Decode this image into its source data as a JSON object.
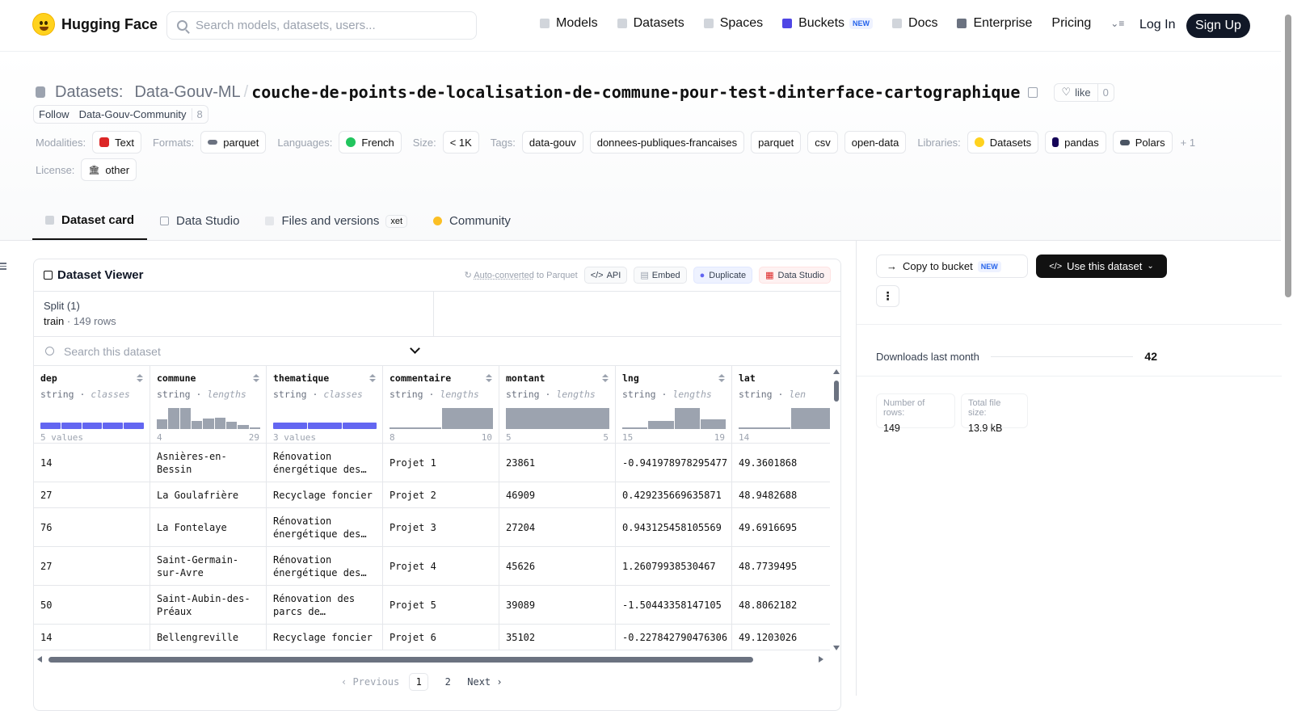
{
  "brand": "Hugging Face",
  "search_placeholder": "Search models, datasets, users...",
  "nav": {
    "models": "Models",
    "datasets": "Datasets",
    "spaces": "Spaces",
    "buckets": "Buckets",
    "buckets_badge": "NEW",
    "docs": "Docs",
    "enterprise": "Enterprise",
    "pricing": "Pricing",
    "login": "Log In",
    "signup": "Sign Up"
  },
  "dataset": {
    "label": "Datasets:",
    "org": "Data-Gouv-ML",
    "sep": "/",
    "name": "couche-de-points-de-localisation-de-commune-pour-test-dinterface-cartographique",
    "like_label": "like",
    "like_count": "0",
    "follow_label": "Follow",
    "follow_org": "Data-Gouv-Community",
    "follow_count": "8"
  },
  "meta": {
    "modalities_label": "Modalities:",
    "modality": "Text",
    "formats_label": "Formats:",
    "format": "parquet",
    "languages_label": "Languages:",
    "language": "French",
    "size_label": "Size:",
    "size": "< 1K",
    "tags_label": "Tags:",
    "tags": [
      "data-gouv",
      "donnees-publiques-francaises",
      "parquet",
      "csv",
      "open-data"
    ],
    "libraries_label": "Libraries:",
    "libraries": [
      "Datasets",
      "pandas",
      "Polars"
    ],
    "libraries_more": "+ 1",
    "license_label": "License:",
    "license": "other"
  },
  "tabs": {
    "card": "Dataset card",
    "studio": "Data Studio",
    "files": "Files and versions",
    "files_badge": "xet",
    "community": "Community"
  },
  "viewer": {
    "title": "Dataset Viewer",
    "auto_prefix": "Auto-converted",
    "auto_suffix": " to Parquet",
    "api": "API",
    "embed": "Embed",
    "duplicate": "Duplicate",
    "data_studio": "Data Studio",
    "split_label": "Split (1)",
    "split_name": "train",
    "split_rows": "149 rows",
    "search_placeholder": "Search this dataset",
    "columns": [
      {
        "name": "dep",
        "type": "string",
        "kind": "classes",
        "range_left": "5 values",
        "range_right": ""
      },
      {
        "name": "commune",
        "type": "string",
        "kind": "lengths",
        "range_left": "4",
        "range_right": "29"
      },
      {
        "name": "thematique",
        "type": "string",
        "kind": "classes",
        "range_left": "3 values",
        "range_right": ""
      },
      {
        "name": "commentaire",
        "type": "string",
        "kind": "lengths",
        "range_left": "8",
        "range_right": "10"
      },
      {
        "name": "montant",
        "type": "string",
        "kind": "lengths",
        "range_left": "5",
        "range_right": "5"
      },
      {
        "name": "lng",
        "type": "string",
        "kind": "lengths",
        "range_left": "15",
        "range_right": "19"
      },
      {
        "name": "lat",
        "type": "string",
        "kind": "len",
        "range_left": "14",
        "range_right": ""
      }
    ],
    "rows": [
      [
        "14",
        "Asnières-en-Bessin",
        "Rénovation énergétique des…",
        "Projet 1",
        "23861",
        "-0.941978978295477",
        "49.3601868"
      ],
      [
        "27",
        "La Goulafrière",
        "Recyclage foncier",
        "Projet 2",
        "46909",
        "0.429235669635871",
        "48.9482688"
      ],
      [
        "76",
        "La Fontelaye",
        "Rénovation énergétique des…",
        "Projet 3",
        "27204",
        "0.943125458105569",
        "49.6916695"
      ],
      [
        "27",
        "Saint-Germain-sur-Avre",
        "Rénovation énergétique des…",
        "Projet 4",
        "45626",
        "1.26079938530467",
        "48.7739495"
      ],
      [
        "50",
        "Saint-Aubin-des-Préaux",
        "Rénovation des parcs de…",
        "Projet 5",
        "39089",
        "-1.50443358147105",
        "48.8062182"
      ],
      [
        "14",
        "Bellengreville",
        "Recyclage foncier",
        "Projet 6",
        "35102",
        "-0.227842790476306",
        "49.1203026"
      ]
    ],
    "pager": {
      "prev": "‹ Previous",
      "p1": "1",
      "p2": "2",
      "next": "Next ›"
    }
  },
  "side": {
    "copy_bucket": "Copy to bucket",
    "copy_badge": "NEW",
    "use_dataset": "Use this dataset",
    "more": "⋮",
    "downloads_label": "Downloads last month",
    "downloads_value": "42",
    "rows_label": "Number of rows:",
    "rows_value": "149",
    "size_label": "Total file size:",
    "size_value": "13.9 kB"
  },
  "colors": {
    "accent": "#6366f1",
    "dark": "#111827",
    "bars": "#9ca3af"
  }
}
